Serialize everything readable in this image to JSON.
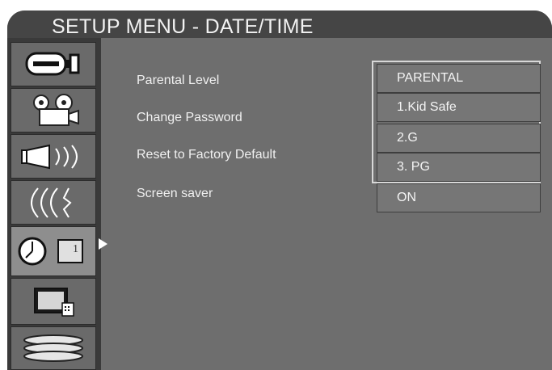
{
  "window": {
    "title": "SETUP MENU - DATE/TIME"
  },
  "sidebar": {
    "items": [
      {
        "icon": "camcorder-icon",
        "active": false
      },
      {
        "icon": "film-projector-icon",
        "active": false
      },
      {
        "icon": "speaker-icon",
        "active": false
      },
      {
        "icon": "subtitle-waves-icon",
        "active": false
      },
      {
        "icon": "clock-icon",
        "active": true,
        "badge": "1"
      },
      {
        "icon": "tv-screen-icon",
        "active": false
      },
      {
        "icon": "disc-stack-icon",
        "active": false
      }
    ]
  },
  "main": {
    "options": [
      {
        "label": "Parental Level"
      },
      {
        "label": "Change Password"
      },
      {
        "label": "Reset to Factory Default"
      },
      {
        "label": "Screen saver"
      }
    ]
  },
  "dropdown": {
    "items": [
      "PARENTAL",
      "1.Kid Safe",
      "2.G",
      "3. PG",
      "ON"
    ]
  },
  "colors": {
    "frame": "#3a3a3a",
    "panel": "#6e6e6e",
    "text": "#f0f0f0"
  }
}
